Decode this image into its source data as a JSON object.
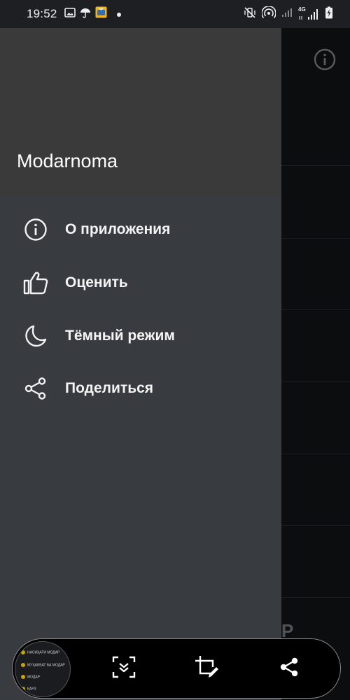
{
  "status_bar": {
    "time": "19:52",
    "network_label": "4G",
    "left_icons": [
      "image-icon",
      "umbrella-icon",
      "tv-app-icon",
      "dot-icon"
    ],
    "right_icons": [
      "mute-vibrate-icon",
      "hotspot-icon",
      "signal-bars-icon",
      "4g-signal-icon",
      "battery-charging-icon"
    ]
  },
  "drawer": {
    "title": "Modarnoma",
    "items": [
      {
        "label": "О приложения",
        "icon": "info-icon"
      },
      {
        "label": "Оценить",
        "icon": "thumbs-up-icon"
      },
      {
        "label": "Тёмный режим",
        "icon": "moon-icon"
      },
      {
        "label": "Поделиться",
        "icon": "share-icon"
      }
    ]
  },
  "background_app": {
    "partial_letter": "P",
    "icon": "info-icon"
  },
  "screenshot_toolbar": {
    "thumbnail_lines": [
      "НАСИҲАТИ МОДАР",
      "МУҲАББАТ БА МОДАР",
      "МОДАР",
      "ҚАРЗ"
    ],
    "buttons": [
      "scroll-capture-icon",
      "crop-edit-icon",
      "share-icon"
    ]
  },
  "colors": {
    "drawer_bg": "#383b40",
    "drawer_header_bg": "#3a3a3a",
    "app_bg": "#131416",
    "text": "#ffffff"
  }
}
